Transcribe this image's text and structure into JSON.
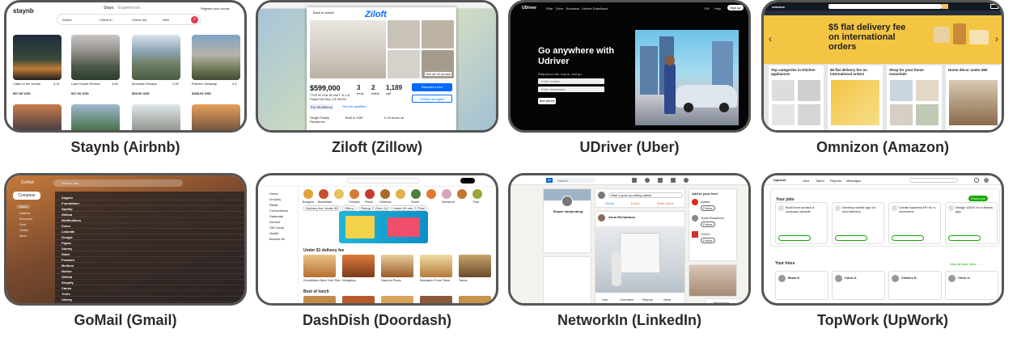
{
  "tiles": [
    {
      "caption": "Staynb (Airbnb)",
      "logo": "staynb",
      "nav": [
        "Stays",
        "Experiences"
      ],
      "host_link": "Register your house",
      "search": {
        "where": "Where",
        "checkin": "Check in",
        "checkout": "Check out",
        "who": "Who"
      },
      "listings": [
        {
          "title": "Cabin in the woods",
          "price": "$97.00 USD",
          "rating": "4.91"
        },
        {
          "title": "Lake House Retreat",
          "price": "$47.00 USD",
          "rating": "4.83"
        },
        {
          "title": "Mountain Escape",
          "price": "$98.00 USD",
          "rating": "4.93"
        },
        {
          "title": "Premier Getaway",
          "price": "$368.00 USD",
          "rating": "4.9"
        }
      ]
    },
    {
      "caption": "Ziloft (Zillow)",
      "logo": "Ziloft",
      "back": "Back to search",
      "price": "$599,000",
      "beds": "3",
      "baths": "2",
      "sqft": "1,189",
      "beds_label": "beds",
      "baths_label": "baths",
      "sqft_label": "sqft",
      "address": "7703 W 51st St UNIT 11 LA, Playa Del Rey, CA 90293",
      "payment": "Est. $3,983/mo",
      "prequal": "Get pre-qualified",
      "see_all": "See all 33 photos",
      "request": "Request a tour",
      "contact": "Contact an agent",
      "facts": [
        "Single Family Residence",
        "Built in 1987",
        "0.16 Acres lot"
      ]
    },
    {
      "caption": "UDriver (Uber)",
      "logo": "UDriver",
      "nav": [
        "Ride",
        "Drive",
        "Business",
        "Udriver Eats",
        "About"
      ],
      "lang": "EN",
      "help": "Help",
      "signup": "Sign up",
      "headline": "Go anywhere with Udriver",
      "subhead": "Request a ride, hop in, and go.",
      "pickup": "Enter location",
      "dropoff": "Enter destination",
      "button": "See prices"
    },
    {
      "caption": "Omnizon (Amazon)",
      "logo": "omnizon",
      "hero": "$5 flat delivery fee on international orders",
      "cards": [
        {
          "title": "Top categories in Kitchen appliances"
        },
        {
          "title": "$5 flat delivery fee on international orders"
        },
        {
          "title": "Shop for your home essentials"
        },
        {
          "title": "Home décor under $50"
        }
      ]
    },
    {
      "caption": "GoMail (Gmail)",
      "logo": "GoMail",
      "search_placeholder": "Search mail",
      "compose": "Compose",
      "folders": [
        "Inbox",
        "Starred",
        "Snoozed",
        "Sent",
        "Drafts",
        "More"
      ],
      "senders": [
        "Zappier",
        "Foundation",
        "Spotify",
        "GitHub",
        "Notifications",
        "Zoom",
        "LinkedIn",
        "Google",
        "Figma",
        "Udemy",
        "Slack",
        "Forward",
        "Medium",
        "Notion",
        "GitHub",
        "Shopify",
        "Canva",
        "Trello",
        "Udemy"
      ]
    },
    {
      "caption": "DashDish (Doordash)",
      "logo": "DashDish",
      "sidebar": [
        "Home",
        "Grocery",
        "Retail",
        "Convenience",
        "Dashmart",
        "Alcohol",
        "Gift Cards",
        "Health",
        "Browse All"
      ],
      "categories": [
        "Burgers",
        "Breakfast",
        "Fast Food",
        "Chicken",
        "Pizza",
        "Chinese",
        "Italian",
        "Sushi",
        "Mexican",
        "Desserts",
        "Indian",
        "Thai"
      ],
      "filters": [
        "Delivery fee: Under $3",
        "Offers",
        "Pickup",
        "Over 4.5",
        "Under 30 min",
        "Price"
      ],
      "section1": "Under $1 delivery fee",
      "section2": "Best of lunch",
      "stores": [
        "Goodtimes New York Subs",
        "Wingstop",
        "Hancos Pizza",
        "Mandarin Food Town",
        "Tacos"
      ]
    },
    {
      "caption": "NetworkIn (LinkedIn)",
      "logo": "in",
      "search_placeholder": "Search",
      "profile_name": "Shawn Vandenberg",
      "post_prompt": "Start a post by writing article",
      "post_actions": [
        "Media",
        "Event",
        "Write article"
      ],
      "post_author": "Anna Richardson",
      "add_feed": "Add to your feed",
      "people": [
        "Adobe",
        "Tuzla Rosanova",
        "TUGO"
      ],
      "follow": "Follow",
      "actions": [
        "Like",
        "Comment",
        "Repost",
        "Send"
      ],
      "messaging": "Messaging"
    },
    {
      "caption": "TopWork (UpWork)",
      "logo": "topwork",
      "nav": [
        "Jobs",
        "Talent",
        "Reports",
        "Messages"
      ],
      "jobs_title": "Your jobs",
      "post_job": "Post a job",
      "job_cards": [
        {
          "title": "Build from scratch a company website"
        },
        {
          "title": "Develop mobile app for food delivery"
        },
        {
          "title": "Create backend API for e-commerce"
        },
        {
          "title": "Design UI/UX for a fitness app"
        }
      ],
      "hires_title": "Your hires",
      "view_all": "View all your hires →",
      "hires": [
        {
          "name": "Brian K."
        },
        {
          "name": "Carol A."
        },
        {
          "name": "Charles D."
        },
        {
          "name": "Chris O."
        }
      ]
    }
  ],
  "colors": {
    "airbnb_red": "#e0384f",
    "zillow_blue": "#006aff",
    "amazon_yellow": "#f3c542",
    "upwork_green": "#14a800",
    "frame_border": "#555555"
  }
}
